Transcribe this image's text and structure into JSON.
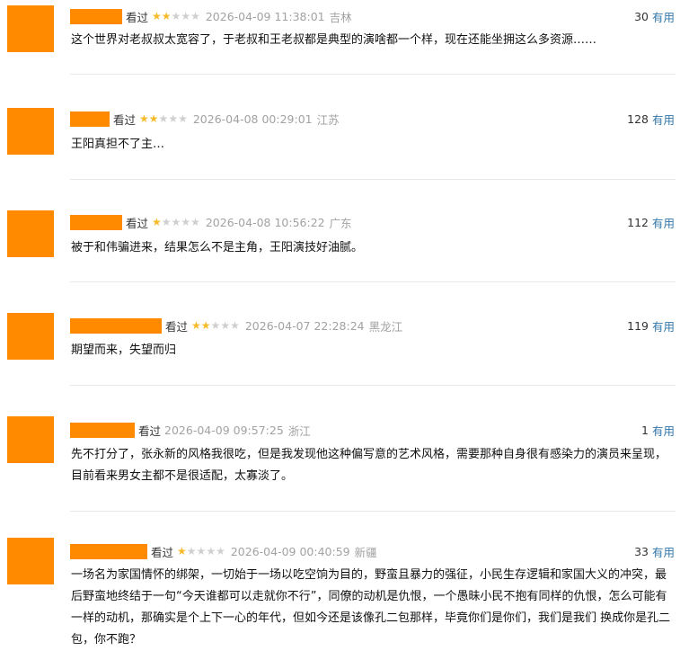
{
  "labels": {
    "watched": "看过",
    "useful": "有用"
  },
  "colors": {
    "avatar": "#ff8a00",
    "star_on": "#f7ba2a",
    "star_off": "#cfcfcf",
    "link": "#3377aa"
  },
  "comments": [
    {
      "rating": 2,
      "time": "2026-04-09 11:38:01",
      "location": "吉林",
      "votes": "30",
      "text": "这个世界对老叔叔太宽容了，于老叔和王老叔都是典型的演啥都一个样，现在还能坐拥这么多资源……"
    },
    {
      "rating": 2,
      "time": "2026-04-08 00:29:01",
      "location": "江苏",
      "votes": "128",
      "text": "王阳真担不了主…"
    },
    {
      "rating": 1,
      "time": "2026-04-08 10:56:22",
      "location": "广东",
      "votes": "112",
      "text": "被于和伟骗进来，结果怎么不是主角，王阳演技好油腻。"
    },
    {
      "rating": 2,
      "time": "2026-04-07 22:28:24",
      "location": "黑龙江",
      "votes": "119",
      "text": "期望而来，失望而归"
    },
    {
      "rating": 0,
      "time": "2026-04-09 09:57:25",
      "location": "浙江",
      "votes": "1",
      "text": "先不打分了，张永新的风格我很吃，但是我发现他这种偏写意的艺术风格，需要那种自身很有感染力的演员来呈现，目前看来男女主都不是很适配，太寡淡了。"
    },
    {
      "rating": 1,
      "time": "2026-04-09 00:40:59",
      "location": "新疆",
      "votes": "33",
      "text": "一场名为家国情怀的绑架，一切始于一场以吃空饷为目的，野蛮且暴力的强征，小民生存逻辑和家国大义的冲突，最后野蛮地终结于一句“今天谁都可以走就你不行”，同僚的动机是仇恨，一个愚昧小民不抱有同样的仇恨，怎么可能有一样的动机，那确实是个上下一心的年代，但如今还是该像孔二包那样，毕竟你们是你们，我们是我们 换成你是孔二包，你不跑？"
    }
  ]
}
